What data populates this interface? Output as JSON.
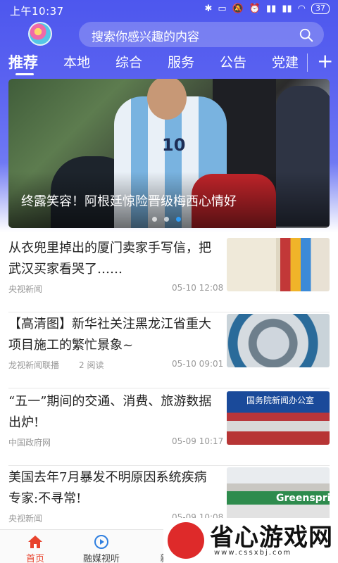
{
  "status_bar": {
    "time": "上午10:37",
    "battery": "37"
  },
  "search": {
    "placeholder": "搜索你感兴趣的内容"
  },
  "tabs": [
    {
      "label": "推荐",
      "active": true
    },
    {
      "label": "本地"
    },
    {
      "label": "综合"
    },
    {
      "label": "服务"
    },
    {
      "label": "公告"
    },
    {
      "label": "党建"
    }
  ],
  "banner": {
    "caption": "终露笑容！阿根廷惊险晋级梅西心情好",
    "jersey_number": "10",
    "dots": 3,
    "active_dot": 3
  },
  "news": [
    {
      "title": "从衣兜里掉出的厦门卖家手写信，把武汉买家看哭了……",
      "source": "央视新闻",
      "reads": "",
      "time": "05-10 12:08"
    },
    {
      "title": "【高清图】新华社关注黑龙江省重大项目施工的繁忙景象~",
      "source": "龙视新闻联播",
      "reads": "2 阅读",
      "time": "05-10 09:01"
    },
    {
      "title": "“五一”期间的交通、消费、旅游数据出炉!",
      "source": "中国政府网",
      "reads": "",
      "time": "05-09 10:17",
      "thumb_text": "国务院新闻办公室"
    },
    {
      "title": "美国去年7月暴发不明原因系统疾病 专家:不寻常!",
      "source": "央视新闻",
      "reads": "",
      "time": "05-09 10:08",
      "thumb_text": "Greenspring"
    }
  ],
  "bottom_nav": [
    {
      "label": "首页",
      "icon": "home-icon",
      "active": true
    },
    {
      "label": "融媒视听",
      "icon": "play-icon"
    },
    {
      "label": "新",
      "icon": "news-icon"
    }
  ],
  "watermark": {
    "text": "省心游戏网",
    "url": "www.cssxbj.com"
  },
  "colors": {
    "header_blue": "#4d57ee",
    "active_nav": "#e8432d",
    "active_dot": "#2f9cf5"
  }
}
